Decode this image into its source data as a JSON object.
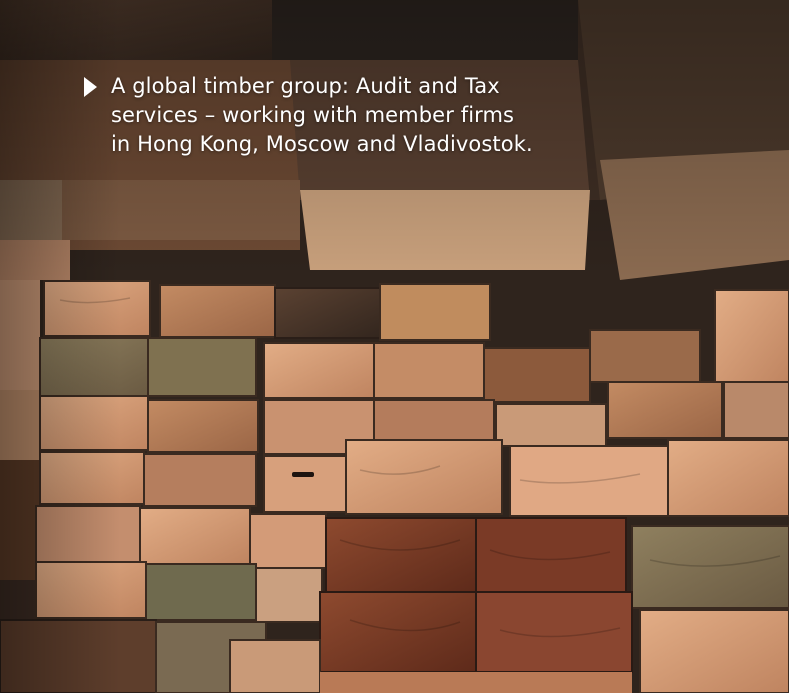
{
  "caption": {
    "lines": [
      "A global timber group: Audit and Tax",
      "services – working with member firms",
      "in Hong Kong, Moscow and Vladivostok."
    ]
  },
  "palette": {
    "dark_wood": "#3a2a20",
    "mid_wood": "#b07a52",
    "light_wood": "#d9a27a",
    "aged_wood": "#7d6a4e",
    "red_wood": "#7e3b25"
  },
  "photo_subject": "stacked-timber-beams"
}
